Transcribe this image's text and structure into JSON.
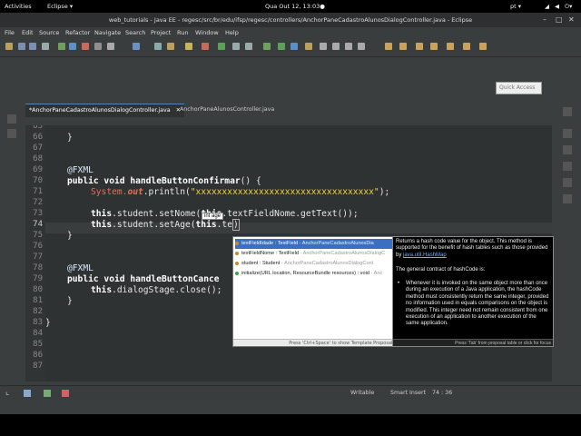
{
  "topbar": {
    "activities": "Activities",
    "app_menu": "Eclipse ▾",
    "clock": "Qua Out 12, 13:03●",
    "keyboard": "pt ▾"
  },
  "window": {
    "title": "web_tutorials - Java EE - regesc/src/br/edu/ifsp/regesc/controllers/AnchorPaneCadastroAlunosDialogController.java - Eclipse",
    "minimize": "–",
    "maximize": "□",
    "close": "✕"
  },
  "menu": [
    "File",
    "Edit",
    "Source",
    "Refactor",
    "Navigate",
    "Search",
    "Project",
    "Run",
    "Window",
    "Help"
  ],
  "quick_access": {
    "placeholder": "Quick Access"
  },
  "tabs": [
    {
      "label": "*AnchorPaneCadastroAlunosDialogController.java",
      "close": "✕"
    },
    {
      "label": "AnchorPaneAlunosController.java"
    }
  ],
  "editor": {
    "line_numbers": [
      "65",
      "66",
      "67",
      "68",
      "69",
      "70",
      "71",
      "72",
      "73",
      "74",
      "75",
      "76",
      "77",
      "78",
      "79",
      "80",
      "81",
      "82",
      "83",
      "84",
      "85",
      "86",
      "87"
    ],
    "lines": {
      "l66": "}",
      "l69": "@FXML",
      "l70_kw": "public void",
      "l70_m": "handleButtonConfirmar",
      "l70_rest": "() {",
      "l71_sys": "System.",
      "l71_out": "out",
      "l71_call": ".println(",
      "l71_str": "\"xxxxxxxxxxxxxxxxxxxxxxxxxxxxxxxxxx\"",
      "l71_end": ");",
      "l73_this": "this",
      "l73_a": ".student.setNome(",
      "l73_b": "this",
      "l73_c": ".textFieldNome.getText());",
      "l74_this": "this",
      "l74_a": ".student.setAge(",
      "l74_b": "this",
      "l74_c": ".te",
      "l74_end": ")",
      "l75": "}",
      "l78": "@FXML",
      "l79_kw": "public void",
      "l79_m": "handleButtonCance",
      "l80_this": "this",
      "l80_rest": ".dialogStage.close();",
      "l81": "}",
      "l83": "}"
    },
    "param_hint": "int age"
  },
  "completion": {
    "items": [
      {
        "name": "textFieldIdade : TextField",
        "owner": " - AnchorPaneCadastroAlunosDia"
      },
      {
        "name": "textFieldNome : TextField",
        "owner": " - AnchorPaneCadastroAlunosDialogC"
      },
      {
        "name": "student : Student",
        "owner": " - AnchorPaneCadastroAlunosDialogCont"
      },
      {
        "name": "initialize(URL location, ResourceBundle resources) : void",
        "owner": " - Anc"
      }
    ],
    "footer": "Press 'Ctrl+Space' to show Template Proposals"
  },
  "javadoc": {
    "p1": "Returns a hash code value for the object. This method is supported for the benefit of hash tables such as those provided by",
    "p1_link": "java.util.HashMap",
    "p2": "The general contract of hashCode is:",
    "bullet": "Whenever it is invoked on the same object more than once during an execution of a Java application, the hashCode method must consistently return the same integer, provided no information used in equals comparisons on the object is modified. This integer need not remain consistent from one execution of an application to another execution of the same application.",
    "footer": "Press 'Tab' from proposal table or click for focus"
  },
  "status": {
    "writable": "Writable",
    "insert_mode": "Smart Insert",
    "position": "74 : 36"
  },
  "colors": {
    "editor_bg": "#2f3233",
    "selection": "#3a6fc2",
    "string": "#f0d43a",
    "static_field": "#f06a55"
  }
}
